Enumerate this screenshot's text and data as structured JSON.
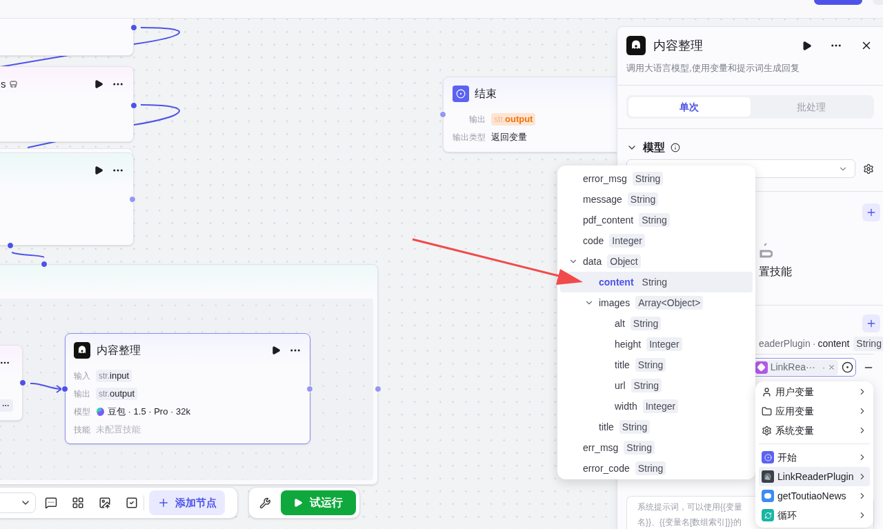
{
  "canvas": {
    "cut_node_title": "s"
  },
  "end_node": {
    "title": "结束",
    "rows": [
      {
        "label": "输出",
        "kind": "var_highlight",
        "prefix": "str.",
        "value": "output"
      },
      {
        "label": "输出类型",
        "kind": "text",
        "value": "返回变量"
      }
    ]
  },
  "llm_node": {
    "title": "内容整理",
    "rows": [
      {
        "label": "输入",
        "kind": "var",
        "prefix": "str.",
        "value": "input"
      },
      {
        "label": "输出",
        "kind": "var",
        "prefix": "str.",
        "value": "output"
      },
      {
        "label": "模型",
        "kind": "model",
        "value": "豆包 · 1.5 · Pro · 32k"
      },
      {
        "label": "技能",
        "kind": "muted",
        "value": "未配置技能"
      }
    ]
  },
  "toolbar": {
    "add_node": "添加节点",
    "test_run": "试运行"
  },
  "panel": {
    "title": "内容整理",
    "description": "调用大语言模型,使用变量和提示词生成回复",
    "tabs": [
      {
        "label": "单次",
        "selected": true
      },
      {
        "label": "批处理",
        "selected": false
      }
    ],
    "model_section": {
      "title": "模型",
      "expanded": true
    },
    "skills_empty": "置技能",
    "output_ref": {
      "source": "eaderPlugin",
      "separator": "·",
      "field": "content",
      "type": "String"
    },
    "variable_tag": {
      "label": "LinkRea···",
      "separator": "·"
    },
    "prompt_placeholder": [
      "系统提示词，可以使用{{变量",
      "名}}、{{变量名[数组索引]}}的"
    ]
  },
  "field_menu": {
    "items": [
      {
        "name": "error_msg",
        "type": "String",
        "selected": false
      },
      {
        "name": "message",
        "type": "String",
        "selected": false
      },
      {
        "name": "pdf_content",
        "type": "String",
        "selected": false
      },
      {
        "name": "code",
        "type": "Integer",
        "selected": false
      },
      {
        "name": "data",
        "type": "Object",
        "selected": false,
        "expanded": true,
        "children": [
          {
            "name": "content",
            "type": "String",
            "selected": true
          },
          {
            "name": "images",
            "type": "Array<Object>",
            "selected": false,
            "expanded": true,
            "children": [
              {
                "name": "alt",
                "type": "String",
                "selected": false
              },
              {
                "name": "height",
                "type": "Integer",
                "selected": false
              },
              {
                "name": "title",
                "type": "String",
                "selected": false
              },
              {
                "name": "url",
                "type": "String",
                "selected": false
              },
              {
                "name": "width",
                "type": "Integer",
                "selected": false
              }
            ]
          },
          {
            "name": "title",
            "type": "String",
            "selected": false
          }
        ]
      },
      {
        "name": "err_msg",
        "type": "String",
        "selected": false
      },
      {
        "name": "error_code",
        "type": "String",
        "selected": false
      }
    ]
  },
  "variable_menu": {
    "groups": [
      {
        "items": [
          {
            "label": "用户变量",
            "kind": "user",
            "selected": false
          },
          {
            "label": "应用变量",
            "kind": "folder",
            "selected": false
          },
          {
            "label": "系统变量",
            "kind": "system",
            "selected": false
          }
        ]
      },
      {
        "items": [
          {
            "label": "开始",
            "kind": "start",
            "selected": false
          },
          {
            "label": "LinkReaderPlugin",
            "kind": "plugin",
            "selected": true
          },
          {
            "label": "getToutiaoNews",
            "kind": "news",
            "selected": false
          },
          {
            "label": "循环",
            "kind": "loop",
            "selected": false
          }
        ]
      }
    ]
  }
}
